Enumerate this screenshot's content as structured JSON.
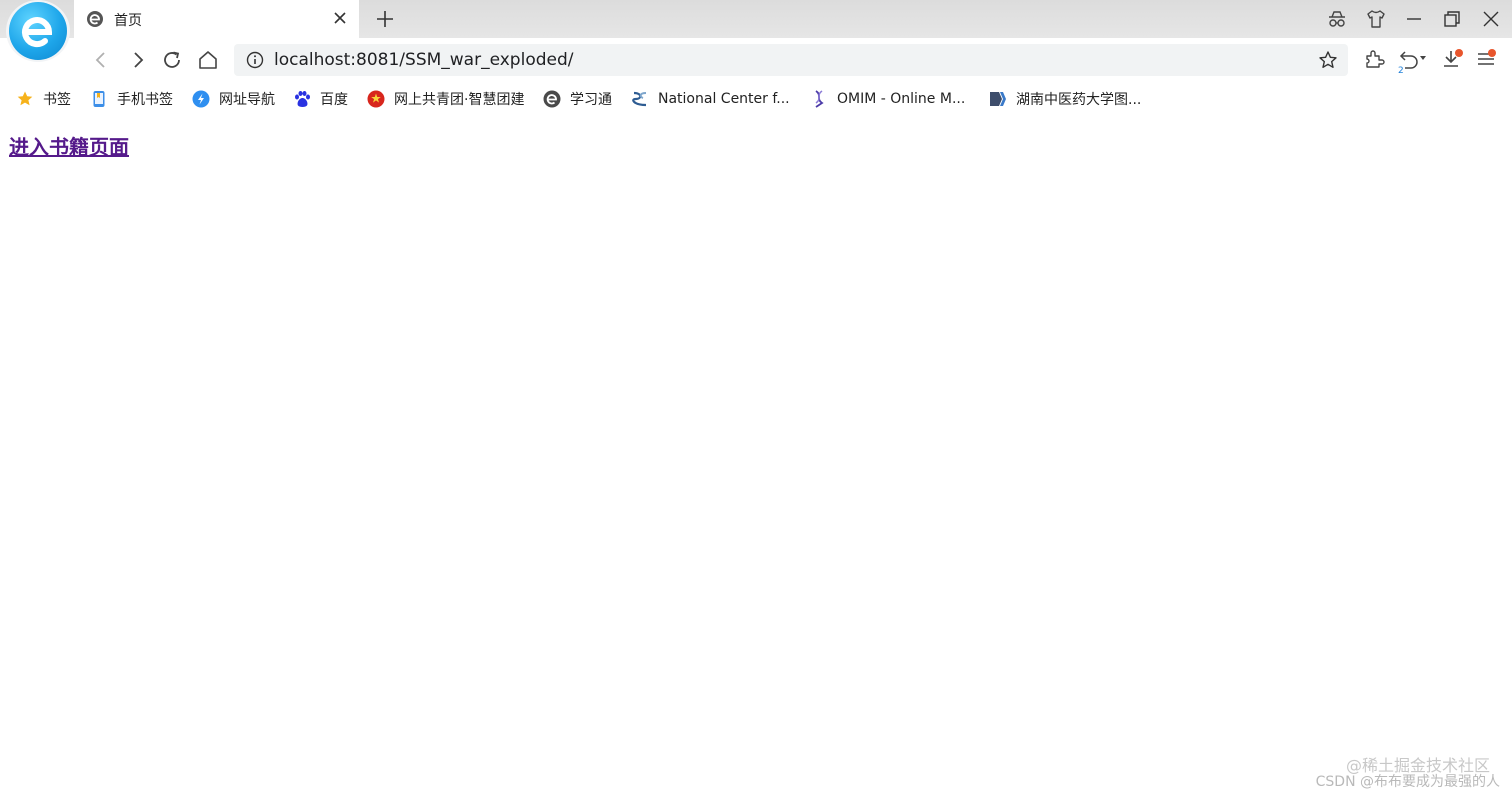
{
  "tab": {
    "title": "首页"
  },
  "address": {
    "url": "localhost:8081/SSM_war_exploded/"
  },
  "toolbar": {
    "history_badge": "2"
  },
  "bookmarks": [
    {
      "label": "书签",
      "icon": "star-icon"
    },
    {
      "label": "手机书签",
      "icon": "phone-bookmark-icon"
    },
    {
      "label": "网址导航",
      "icon": "navigation-icon"
    },
    {
      "label": "百度",
      "icon": "baidu-paw-icon"
    },
    {
      "label": "网上共青团·智慧团建",
      "icon": "youth-league-icon"
    },
    {
      "label": "学习通",
      "icon": "xuexitong-icon"
    },
    {
      "label": "National Center f...",
      "icon": "ncbi-icon"
    },
    {
      "label": "OMIM - Online M...",
      "icon": "omim-icon"
    },
    {
      "label": "湖南中医药大学图...",
      "icon": "library-icon"
    }
  ],
  "page": {
    "link_text": "进入书籍页面"
  },
  "watermark": {
    "line1": "@稀土掘金技术社区",
    "line2": "CSDN @布布要成为最强的人"
  },
  "colors": {
    "accent": "#1ea6ea",
    "link_visited": "#551a8b",
    "badge": "#e8552c"
  }
}
